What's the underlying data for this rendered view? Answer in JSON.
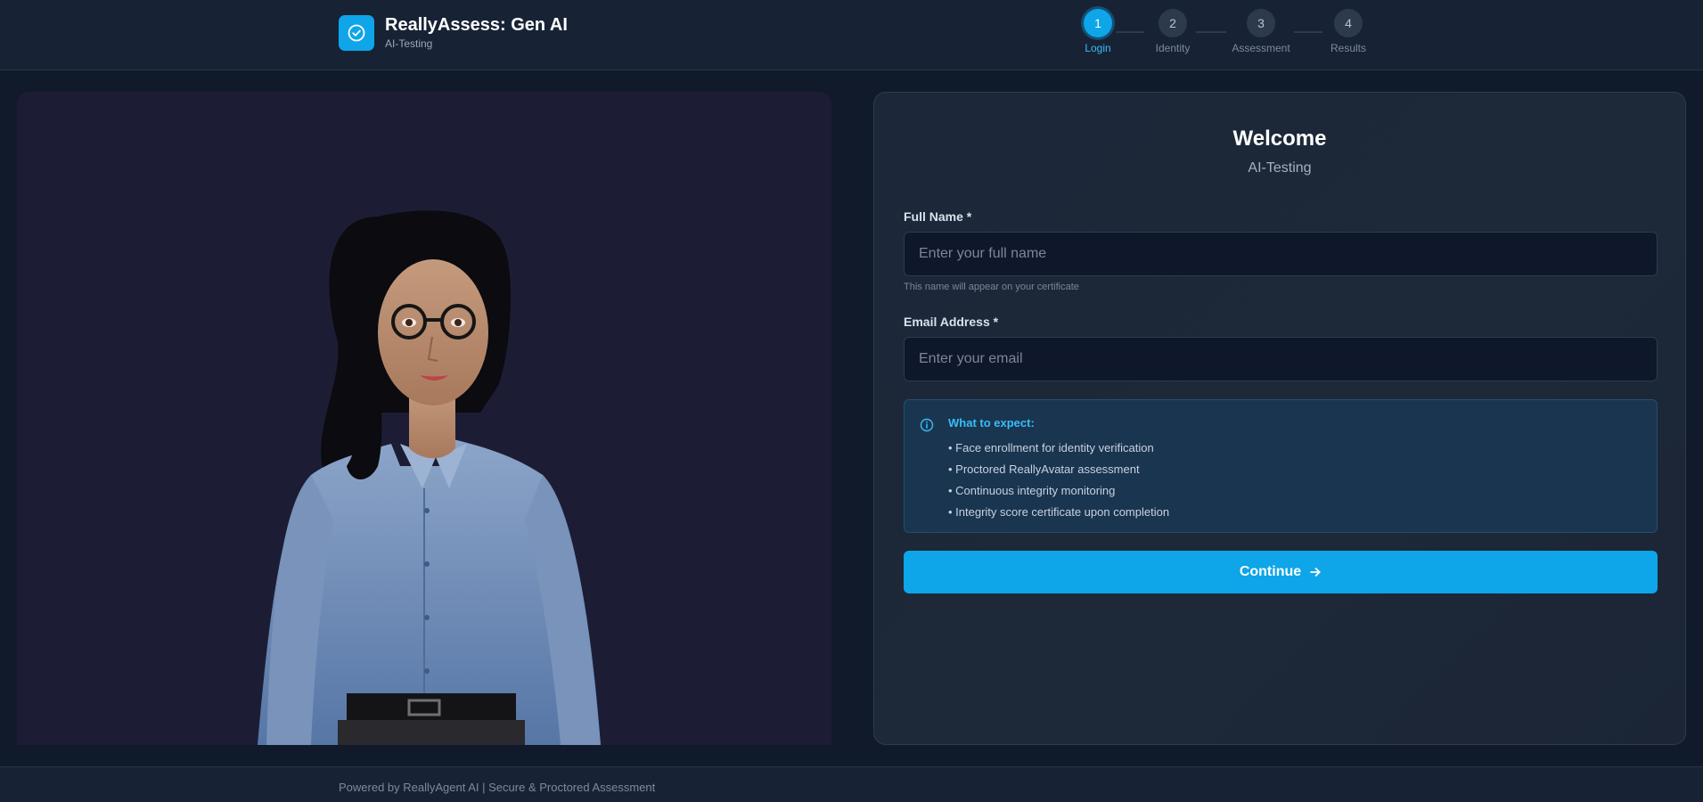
{
  "header": {
    "title": "ReallyAssess: Gen AI",
    "subtitle": "AI-Testing",
    "logo_icon": "check-circle-icon",
    "accent_color": "#0ea5e9"
  },
  "steps": [
    {
      "number": "1",
      "label": "Login",
      "active": true
    },
    {
      "number": "2",
      "label": "Identity",
      "active": false
    },
    {
      "number": "3",
      "label": "Assessment",
      "active": false
    },
    {
      "number": "4",
      "label": "Results",
      "active": false
    }
  ],
  "login": {
    "welcome": "Welcome",
    "subtitle": "AI-Testing",
    "full_name_label": "Full Name *",
    "full_name_placeholder": "Enter your full name",
    "full_name_value": "",
    "full_name_hint": "This name will appear on your certificate",
    "email_label": "Email Address *",
    "email_placeholder": "Enter your email",
    "email_value": "",
    "info_icon": "info-icon",
    "info_title": "What to expect:",
    "info_items": [
      "• Face enrollment for identity verification",
      "• Proctored ReallyAvatar assessment",
      "• Continuous integrity monitoring",
      "• Integrity score certificate upon completion"
    ],
    "continue_label": "Continue",
    "continue_icon": "arrow-right-icon"
  },
  "footer": {
    "text": "Powered by ReallyAgent AI | Secure & Proctored Assessment"
  }
}
